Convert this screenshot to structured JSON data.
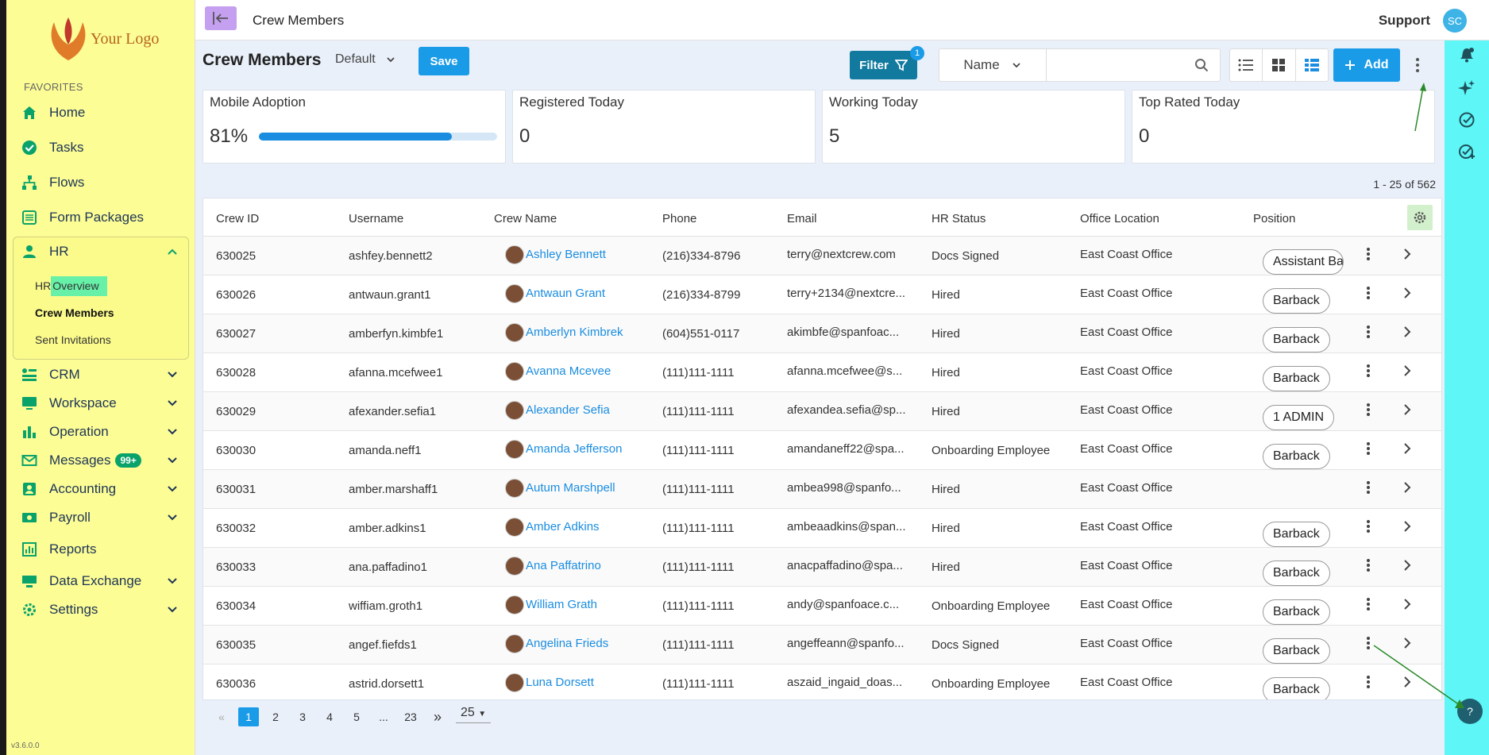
{
  "brand": {
    "logo_text": "Your Logo",
    "version": "v3.6.0.0"
  },
  "sidebar": {
    "favorites_label": "FAVORITES",
    "items": [
      {
        "label": "Home",
        "icon": "home-icon"
      },
      {
        "label": "Tasks",
        "icon": "check-circle-icon"
      },
      {
        "label": "Flows",
        "icon": "flow-icon"
      },
      {
        "label": "Form Packages",
        "icon": "form-icon"
      },
      {
        "label": "HR",
        "icon": "person-icon"
      },
      {
        "label": "CRM",
        "icon": "crm-icon"
      },
      {
        "label": "Workspace",
        "icon": "monitor-icon"
      },
      {
        "label": "Operation",
        "icon": "bar-chart-icon"
      },
      {
        "label": "Messages",
        "icon": "mail-icon",
        "badge": "99+"
      },
      {
        "label": "Accounting",
        "icon": "accounting-icon"
      },
      {
        "label": "Payroll",
        "icon": "money-icon"
      },
      {
        "label": "Reports",
        "icon": "report-icon"
      },
      {
        "label": "Data Exchange",
        "icon": "exchange-icon"
      },
      {
        "label": "Settings",
        "icon": "gear-icon"
      }
    ],
    "hr_sub": {
      "overview_prefix": "HR",
      "overview_suffix": "Overview",
      "crew": "Crew Members",
      "invites": "Sent Invitations"
    }
  },
  "topbar": {
    "title": "Crew Members",
    "support": "Support",
    "avatar": "SC"
  },
  "page": {
    "title": "Crew Members",
    "view": "Default",
    "save": "Save",
    "filter": "Filter",
    "filter_count": "1",
    "search_field": "Name",
    "search_placeholder": "",
    "add": "Add",
    "range": "1 - 25 of 562"
  },
  "kpis": [
    {
      "label": "Mobile Adoption",
      "value": "81%",
      "progress": 0.81
    },
    {
      "label": "Registered Today",
      "value": "0"
    },
    {
      "label": "Working Today",
      "value": "5"
    },
    {
      "label": "Top Rated Today",
      "value": "0"
    }
  ],
  "table": {
    "headers": [
      "Crew ID",
      "Username",
      "Crew Name",
      "Phone",
      "Email",
      "HR Status",
      "Office Location",
      "Position"
    ],
    "rows": [
      {
        "id": "630025",
        "user": "ashfey.bennett2",
        "name": "Ashley Bennett",
        "phone": "(216)334-8796",
        "email": "terry@nextcrew.com",
        "status": "Docs Signed",
        "office": "East Coast Office",
        "position": "Assistant Bar"
      },
      {
        "id": "630026",
        "user": "antwaun.grant1",
        "name": "Antwaun Grant",
        "phone": "(216)334-8799",
        "email": "terry+2134@nextcre...",
        "status": "Hired",
        "office": "East Coast Office",
        "position": "Barback"
      },
      {
        "id": "630027",
        "user": "amberfyn.kimbfe1",
        "name": "Amberlyn Kimbrek",
        "phone": "(604)551-0117",
        "email": "akimbfe@spanfoac...",
        "status": "Hired",
        "office": "East Coast Office",
        "position": "Barback"
      },
      {
        "id": "630028",
        "user": "afanna.mcefwee1",
        "name": "Avanna Mcevee",
        "phone": "(111)111-1111",
        "email": "afanna.mcefwee@s...",
        "status": "Hired",
        "office": "East Coast Office",
        "position": "Barback"
      },
      {
        "id": "630029",
        "user": "afexander.sefia1",
        "name": "Alexander Sefia",
        "phone": "(111)111-1111",
        "email": "afexandea.sefia@sp...",
        "status": "Hired",
        "office": "East Coast Office",
        "position": "1 ADMIN"
      },
      {
        "id": "630030",
        "user": "amanda.neff1",
        "name": "Amanda Jefferson",
        "phone": "(111)111-1111",
        "email": "amandaneff22@spa...",
        "status": "Onboarding Employee",
        "office": "East Coast Office",
        "position": "Barback"
      },
      {
        "id": "630031",
        "user": "amber.marshaff1",
        "name": "Autum Marshpell",
        "phone": "(111)111-1111",
        "email": "ambea998@spanfo...",
        "status": "Hired",
        "office": "East Coast Office",
        "position": ""
      },
      {
        "id": "630032",
        "user": "amber.adkins1",
        "name": "Amber Adkins",
        "phone": "(111)111-1111",
        "email": "ambeaadkins@span...",
        "status": "Hired",
        "office": "East Coast Office",
        "position": "Barback"
      },
      {
        "id": "630033",
        "user": "ana.paffadino1",
        "name": "Ana Paffatrino",
        "phone": "(111)111-1111",
        "email": "anacpaffadino@spa...",
        "status": "Hired",
        "office": "East Coast Office",
        "position": "Barback"
      },
      {
        "id": "630034",
        "user": "wiffiam.groth1",
        "name": "William Grath",
        "phone": "(111)111-1111",
        "email": "andy@spanfoace.c...",
        "status": "Onboarding Employee",
        "office": "East Coast Office",
        "position": "Barback"
      },
      {
        "id": "630035",
        "user": "angef.fiefds1",
        "name": "Angelina Frieds",
        "phone": "(111)111-1111",
        "email": "angeffeann@spanfo...",
        "status": "Docs Signed",
        "office": "East Coast Office",
        "position": "Barback"
      },
      {
        "id": "630036",
        "user": "astrid.dorsett1",
        "name": "Luna Dorsett",
        "phone": "(111)111-1111",
        "email": "aszaid_ingaid_doas...",
        "status": "Onboarding Employee",
        "office": "East Coast Office",
        "position": "Barback"
      }
    ]
  },
  "pager": {
    "pages": [
      "1",
      "2",
      "3",
      "4",
      "5",
      "...",
      "23"
    ],
    "current": "1",
    "per_page": "25"
  }
}
